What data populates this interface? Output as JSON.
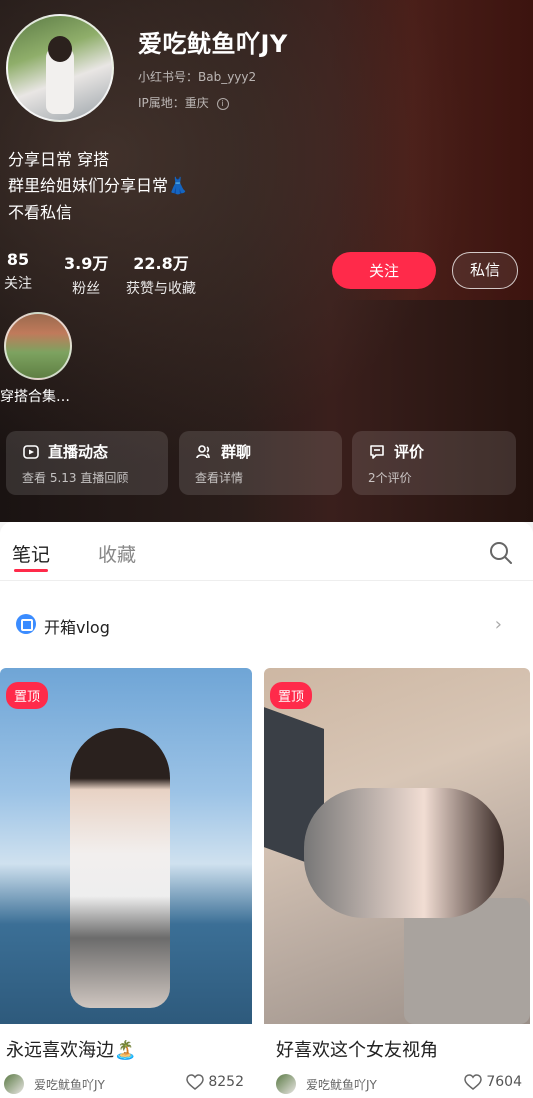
{
  "profile": {
    "name": "爱吃鱿鱼吖JY",
    "id_line": "小红书号：Bab_yyy2",
    "ip_line": "IP属地：重庆",
    "bio": [
      "分享日常 穿搭",
      "群里给姐妹们分享日常👗",
      "不看私信"
    ],
    "stats": [
      {
        "value": "85",
        "label": "关注"
      },
      {
        "value": "3.9万",
        "label": "粉丝"
      },
      {
        "value": "22.8万",
        "label": "获赞与收藏"
      }
    ],
    "follow_label": "关注",
    "message_label": "私信",
    "collection_label": "穿搭合集…"
  },
  "cards": [
    {
      "title": "直播动态",
      "sub": "查看 5.13 直播回顾",
      "icon": "live-icon"
    },
    {
      "title": "群聊",
      "sub": "查看详情",
      "icon": "group-icon"
    },
    {
      "title": "评价",
      "sub": "2个评价",
      "icon": "comment-icon"
    }
  ],
  "tabs": {
    "notes": "笔记",
    "favorites": "收藏"
  },
  "vlog": {
    "label": "开箱vlog"
  },
  "posts": [
    {
      "pin": "置顶",
      "title": "永远喜欢海边🏝️",
      "author": "爱吃鱿鱼吖JY",
      "likes": "8252"
    },
    {
      "pin": "置顶",
      "title": "好喜欢这个女友视角",
      "author": "爱吃鱿鱼吖JY",
      "likes": "7604"
    }
  ],
  "colors": {
    "accent": "#ff2a4a"
  }
}
